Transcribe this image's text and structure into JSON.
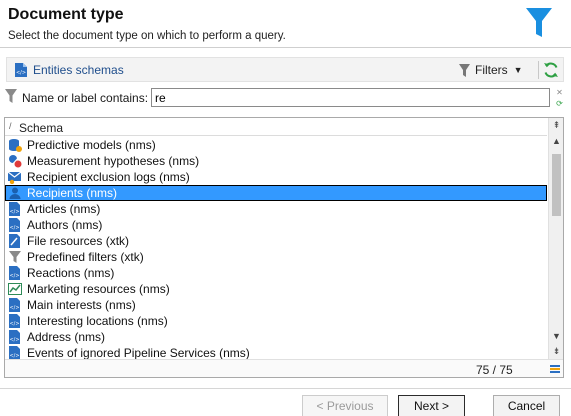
{
  "header": {
    "title": "Document type",
    "subtitle": "Select the document type on which to perform a query."
  },
  "toolbar": {
    "schema_label": "Entities schemas",
    "filters_label": "Filters"
  },
  "filter": {
    "label": "Name or label contains:",
    "value": "re"
  },
  "list": {
    "column_header": "Schema",
    "rows": [
      {
        "label": "Predictive models (nms)",
        "icon": "database-icon"
      },
      {
        "label": "Measurement hypotheses (nms)",
        "icon": "hypothesis-icon"
      },
      {
        "label": "Recipient exclusion logs (nms)",
        "icon": "exclusion-log-icon"
      },
      {
        "label": "Recipients (nms)",
        "icon": "recipient-icon",
        "selected": true
      },
      {
        "label": "Articles (nms)",
        "icon": "schema-doc-icon"
      },
      {
        "label": "Authors (nms)",
        "icon": "schema-doc-icon"
      },
      {
        "label": "File resources (xtk)",
        "icon": "file-resource-icon"
      },
      {
        "label": "Predefined filters (xtk)",
        "icon": "funnel-icon"
      },
      {
        "label": "Reactions (nms)",
        "icon": "schema-doc-icon"
      },
      {
        "label": "Marketing resources (nms)",
        "icon": "chart-icon"
      },
      {
        "label": "Main interests (nms)",
        "icon": "schema-doc-icon"
      },
      {
        "label": "Interesting locations (nms)",
        "icon": "schema-doc-icon"
      },
      {
        "label": "Address (nms)",
        "icon": "schema-doc-icon"
      },
      {
        "label": "Events of ignored Pipeline Services (nms)",
        "icon": "schema-doc-icon"
      }
    ],
    "count": "75 / 75"
  },
  "buttons": {
    "previous": "< Previous",
    "next": "Next >",
    "cancel": "Cancel"
  },
  "colors": {
    "accent_blue": "#1a8fe0",
    "selection": "#3399ff",
    "refresh_green": "#2ea043"
  }
}
